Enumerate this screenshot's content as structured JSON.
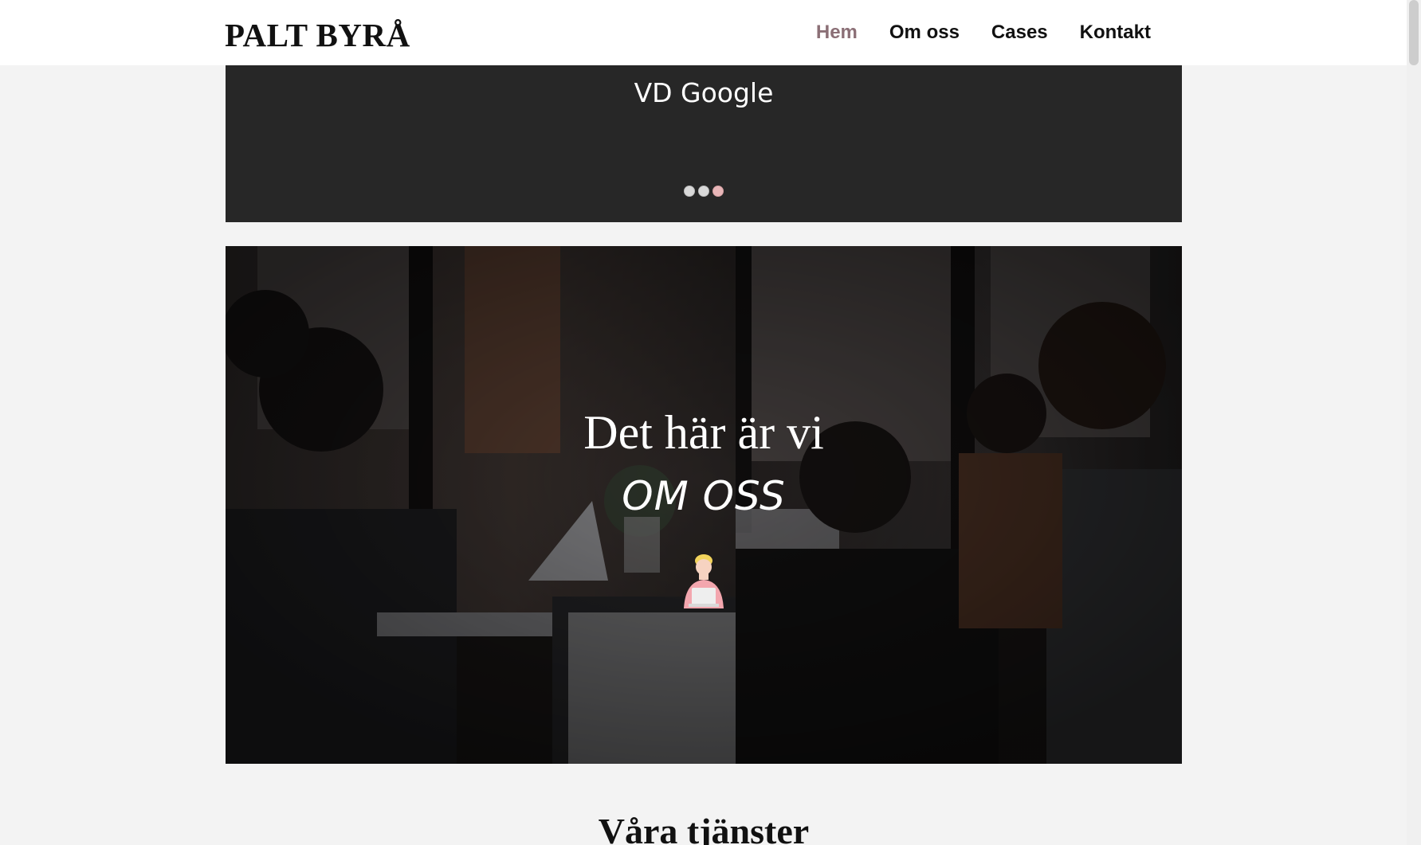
{
  "header": {
    "logo": "PALT BYRÅ",
    "nav": [
      {
        "label": "Hem",
        "active": true
      },
      {
        "label": "Om oss",
        "active": false
      },
      {
        "label": "Cases",
        "active": false
      },
      {
        "label": "Kontakt",
        "active": false
      }
    ]
  },
  "slider": {
    "quote_text": "VD Google",
    "dots": 3,
    "active_dot": 3
  },
  "hero": {
    "title": "Det här är vi",
    "subtitle": "OM OSS",
    "icons": [
      "person-with-laptop-illustration"
    ]
  },
  "services": {
    "title": "Våra tjänster"
  },
  "colors": {
    "nav_active": "#8b6f76",
    "slider_bg": "#272727",
    "page_bg": "#f3f3f3",
    "dot_active": "#e8b6b8"
  }
}
